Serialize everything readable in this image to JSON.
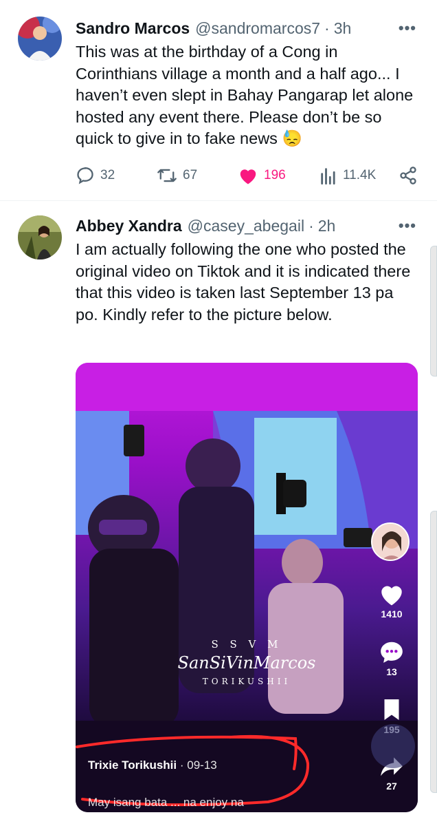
{
  "tweets": [
    {
      "name": "Sandro Marcos",
      "handle": "@sandromarcos7",
      "time": "3h",
      "text": "This was at the birthday of a Cong in Corinthians village a month and a half ago... I haven’t even slept in Bahay Pangarap let alone hosted any event there. Please don’t be so quick to give in to fake news 😓",
      "replies": "32",
      "retweets": "67",
      "likes": "196",
      "views": "11.4K"
    },
    {
      "name": "Abbey Xandra",
      "handle": "@casey_abegail",
      "time": "2h",
      "text": "I am actually following the one who posted the original video on Tiktok and it is indicated there that this video is taken last September 13 pa po. Kindly refer to the picture below."
    }
  ],
  "media": {
    "watermark_top": "S S V M",
    "watermark_main": "SanSiVinMarcos",
    "watermark_bottom": "TORIKUSHII",
    "likes": "1410",
    "comments": "13",
    "saves": "195",
    "shares": "27",
    "creator": "Trixie Torikushii",
    "date": "09-13",
    "caption": "May isang bata ... na enjoy na"
  },
  "icons": {
    "more": "more-icon",
    "reply": "reply-icon",
    "retweet": "retweet-icon",
    "like": "heart-icon",
    "views": "views-icon",
    "share": "share-icon"
  },
  "colors": {
    "like_active": "#f91880",
    "secondary_text": "#536471",
    "annotation_circle": "#ff2a2a"
  }
}
